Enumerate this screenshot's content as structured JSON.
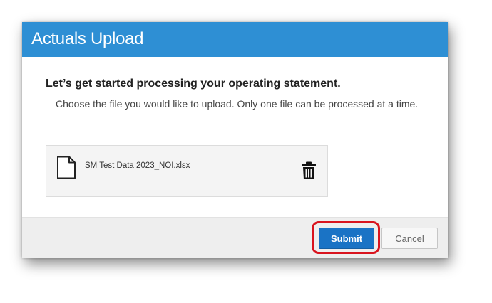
{
  "dialog": {
    "title": "Actuals Upload",
    "heading": "Let’s get started processing your operating statement.",
    "instructions": "Choose the file you would like to upload. Only one file can be processed at a time."
  },
  "file": {
    "name": "SM Test Data 2023_NOI.xlsx",
    "icon": "document-icon",
    "delete_icon": "trash-icon"
  },
  "footer": {
    "submit_label": "Submit",
    "cancel_label": "Cancel"
  },
  "colors": {
    "header": "#2e8fd4",
    "submit": "#1a73c5",
    "highlight": "#d9141e"
  }
}
